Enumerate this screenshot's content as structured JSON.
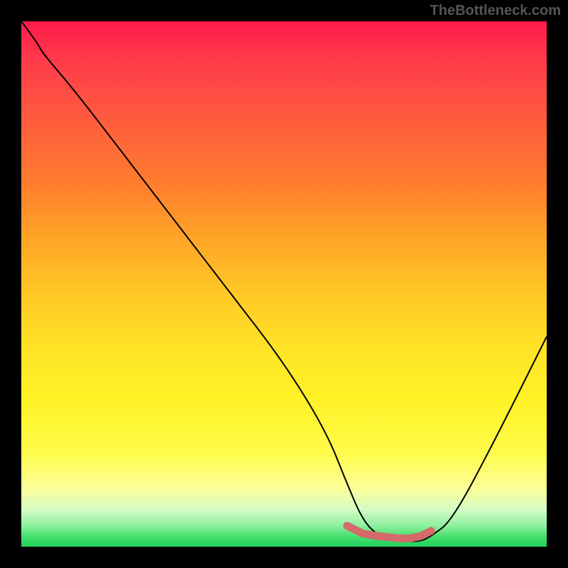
{
  "watermark": "TheBottleneck.com",
  "chart_data": {
    "type": "line",
    "title": "",
    "xlabel": "",
    "ylabel": "",
    "xlim": [
      0,
      100
    ],
    "ylim": [
      0,
      100
    ],
    "series": [
      {
        "name": "bottleneck-curve",
        "x": [
          0,
          3,
          4,
          10,
          20,
          30,
          40,
          50,
          58,
          62,
          65,
          68,
          72,
          76,
          78,
          82,
          90,
          100
        ],
        "y": [
          100,
          96,
          94,
          87,
          74,
          61,
          48,
          35,
          22,
          12,
          5,
          2,
          1,
          1,
          2,
          5,
          20,
          40
        ]
      }
    ],
    "highlight": {
      "name": "optimal-range",
      "color": "#d46a6a",
      "x": [
        62,
        65,
        68,
        70,
        72,
        74,
        76,
        78
      ],
      "y": [
        4,
        2.5,
        2,
        1.8,
        1.6,
        1.6,
        2,
        3
      ]
    },
    "note": "y values are percentages of full plot height; x values are percentages of full plot width; axes have no visible tick labels in the source image so ranges are normalized 0-100."
  }
}
